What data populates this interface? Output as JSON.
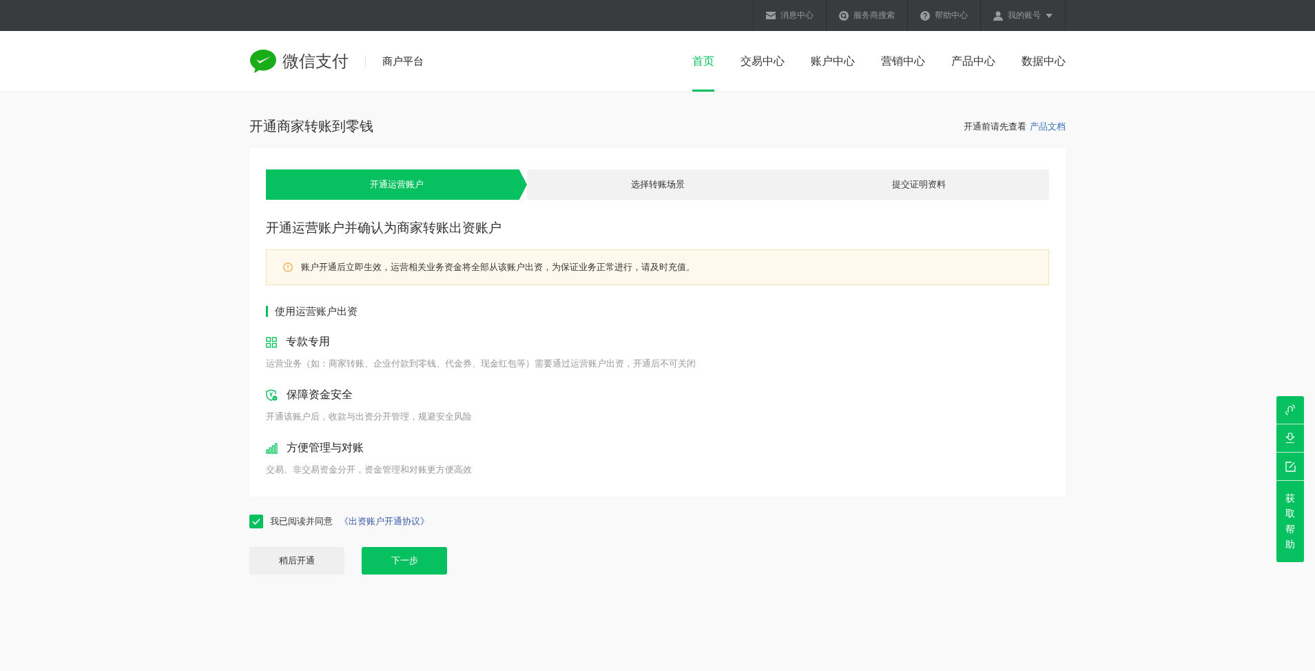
{
  "top_bar": {
    "items": [
      {
        "kind": "mail",
        "label": "消息中心"
      },
      {
        "kind": "search",
        "label": "服务商搜索"
      },
      {
        "kind": "help",
        "label": "帮助中心"
      },
      {
        "kind": "user",
        "label": "我的账号",
        "dropdown": true
      }
    ]
  },
  "header": {
    "brand": "微信支付",
    "platform": "商户平台",
    "nav": [
      {
        "label": "首页",
        "selected": true
      },
      {
        "label": "交易中心",
        "selected": false
      },
      {
        "label": "账户中心",
        "selected": false
      },
      {
        "label": "营销中心",
        "selected": false
      },
      {
        "label": "产品中心",
        "selected": false
      },
      {
        "label": "数据中心",
        "selected": false
      }
    ]
  },
  "page": {
    "title": "开通商家转账到零钱",
    "doc_hint": "开通前请先查看",
    "doc_link": "产品文档"
  },
  "steps": [
    {
      "label": "开通运营账户",
      "selected": true
    },
    {
      "label": "选择转账场景",
      "selected": false
    },
    {
      "label": "提交证明资料",
      "selected": false
    }
  ],
  "card": {
    "heading": "开通运营账户并确认为商家转账出资账户",
    "notice": "账户开通后立即生效，运营相关业务资金将全部从该账户出资，为保证业务正常进行，请及时充值。",
    "section_title": "使用运营账户出资",
    "features": [
      {
        "kind": "grid",
        "title": "专款专用",
        "description": "运营业务（如：商家转账、企业付款到零钱、代金券、现金红包等）需要通过运营账户出资，开通后不可关闭"
      },
      {
        "kind": "shield",
        "title": "保障资金安全",
        "description": "开通该账户后，收款与出资分开管理，规避安全风险"
      },
      {
        "kind": "bars",
        "title": "方便管理与对账",
        "description": "交易、非交易资金分开，资金管理和对账更方便高效"
      }
    ]
  },
  "agreement": {
    "checked": true,
    "text": "我已阅读并同意",
    "link": "《出资账户开通协议》"
  },
  "buttons": [
    {
      "kind": "secondary",
      "label": "稍后开通"
    },
    {
      "kind": "primary",
      "label": "下一步"
    }
  ],
  "float_panel": {
    "tools": [
      {
        "kind": "link"
      },
      {
        "kind": "download"
      },
      {
        "kind": "edit"
      }
    ],
    "help": "获取帮助"
  }
}
